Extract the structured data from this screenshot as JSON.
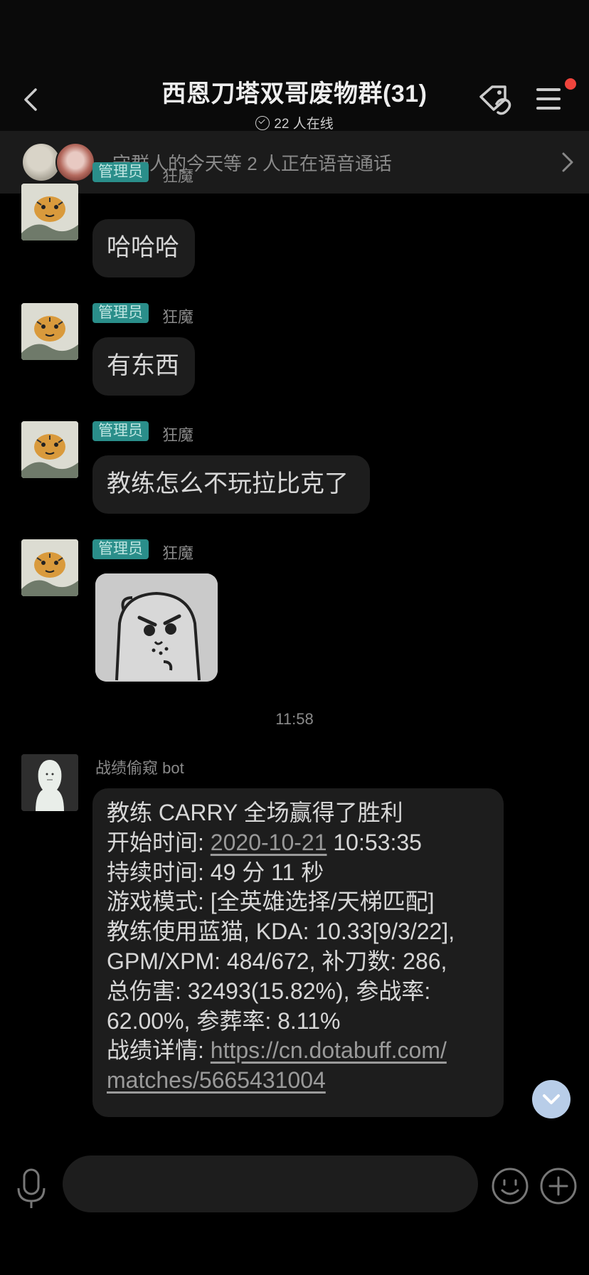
{
  "header": {
    "title": "西恩刀塔双哥废物群(31)",
    "online_count": "22 人在线"
  },
  "voice_bar": {
    "text": "守群人的今天等 2 人正在语音通话"
  },
  "messages": [
    {
      "role": "管理员",
      "user": "狂魔",
      "text": "哈哈哈"
    },
    {
      "role": "管理员",
      "user": "狂魔",
      "text": "有东西"
    },
    {
      "role": "管理员",
      "user": "狂魔",
      "text": "教练怎么不玩拉比克了"
    },
    {
      "role": "管理员",
      "user": "狂魔",
      "type": "sticker"
    }
  ],
  "time_separator": "11:58",
  "bot_message": {
    "user": "战绩偷窥 bot",
    "lines": {
      "l1": "教练 CARRY 全场赢得了胜利",
      "l2_label": "开始时间: ",
      "l2_date": "2020-10-21",
      "l2_time": " 10:53:35",
      "l3": "持续时间: 49 分 11 秒",
      "l4": "游戏模式: [全英雄选择/天梯匹配]",
      "l5": "教练使用蓝猫, KDA: 10.33[9/3/22],",
      "l6": "GPM/XPM: 484/672, 补刀数: 286,",
      "l7": "总伤害: 32493(15.82%), 参战率:",
      "l8": "62.00%, 参葬率: 8.11%",
      "l9_label": "战绩详情: ",
      "link_part1": "https://cn.dotabuff.com/",
      "link_part2": "matches/5665431004"
    }
  },
  "input": {
    "placeholder": ""
  },
  "colors": {
    "background": "#000000",
    "bubble": "#1d1d1d",
    "role_badge": "#2a8e8a",
    "notification_dot": "#f0443c",
    "scroll_button": "#b8cde8"
  }
}
